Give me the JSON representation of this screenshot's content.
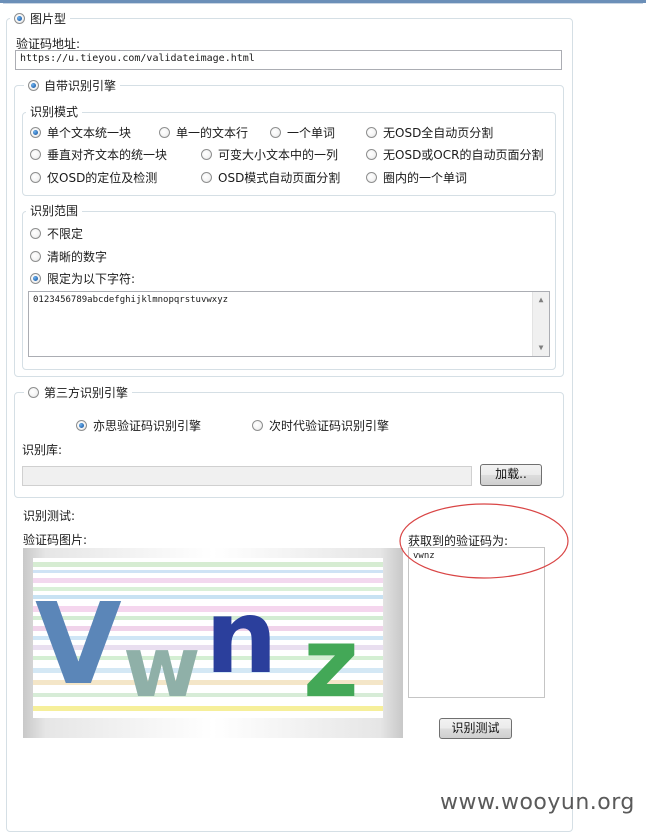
{
  "image_mode": {
    "label": "图片型"
  },
  "captcha_url": {
    "label": "验证码地址:",
    "value": "https://u.tieyou.com/validateimage.html"
  },
  "builtin_engine": {
    "label": "自带识别引擎",
    "mode_group": {
      "title": "识别模式",
      "options": [
        "单个文本统一块",
        "单一的文本行",
        "一个单词",
        "无OSD全自动页分割",
        "垂直对齐文本的统一块",
        "可变大小文本中的一列",
        "无OSD或OCR的自动页面分割",
        "仅OSD的定位及检测",
        "OSD模式自动页面分割",
        "圈内的一个单词"
      ]
    },
    "range_group": {
      "title": "识别范围",
      "options": [
        "不限定",
        "清晰的数字",
        "限定为以下字符:"
      ],
      "charset": "0123456789abcdefghijklmnopqrstuvwxyz"
    }
  },
  "third_party": {
    "label": "第三方识别引擎",
    "engine_a": "亦思验证码识别引擎",
    "engine_b": "次时代验证码识别引擎",
    "library_label": "识别库:",
    "load_button": "加载.."
  },
  "test": {
    "title": "识别测试:",
    "image_label": "验证码图片:",
    "captcha_chars": [
      "V",
      "w",
      "n",
      "z"
    ],
    "result_label": "获取到的验证码为:",
    "result_value": "vwnz",
    "test_button": "识别测试"
  },
  "watermark": "www.wooyun.org",
  "colors": {
    "highlight_circle": "#d94545",
    "captcha_v": "#5b86b8",
    "captcha_w": "#8fb0a8",
    "captcha_n": "#2b3f9c",
    "captcha_z": "#43a857"
  }
}
